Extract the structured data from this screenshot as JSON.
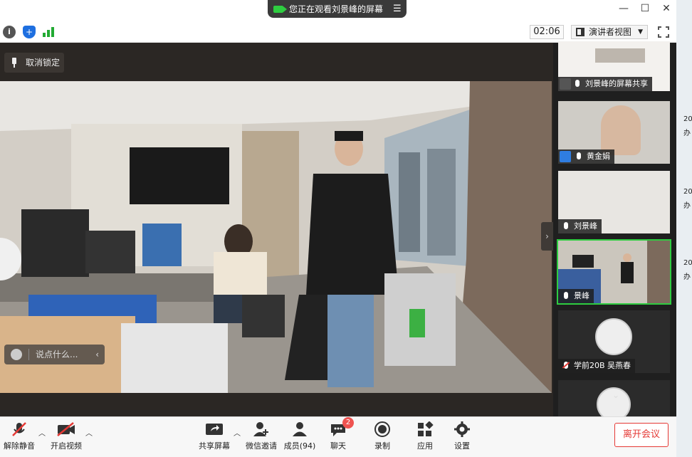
{
  "titlebar": {
    "share_banner": "您正在观看刘景峰的屏幕"
  },
  "infobar": {
    "timer": "02:06",
    "view_mode": "演讲者视图"
  },
  "stage": {
    "unpin_label": "取消锁定",
    "chat_placeholder": "说点什么..."
  },
  "participants": [
    {
      "name": "刘景峰的屏幕共享",
      "muted": false
    },
    {
      "name": "黄金娟",
      "muted": false
    },
    {
      "name": "刘景峰",
      "muted": false
    },
    {
      "name": "景峰",
      "muted": false
    },
    {
      "name": "学前20B 吴燕春",
      "muted": true
    }
  ],
  "edge_text": [
    "20",
    "办",
    "20",
    "办",
    "20",
    "办"
  ],
  "bottombar": {
    "unmute": "解除静音",
    "start_video": "开启视频",
    "share_screen": "共享屏幕",
    "wechat_invite": "微信邀请",
    "members": "成员(94)",
    "chat": "聊天",
    "chat_badge": "2",
    "record": "录制",
    "apps": "应用",
    "settings": "设置",
    "leave": "离开会议"
  },
  "colors": {
    "accent_green": "#2ecc40",
    "leave_red": "#e53935",
    "tile_bg": "#2b2b2b"
  }
}
